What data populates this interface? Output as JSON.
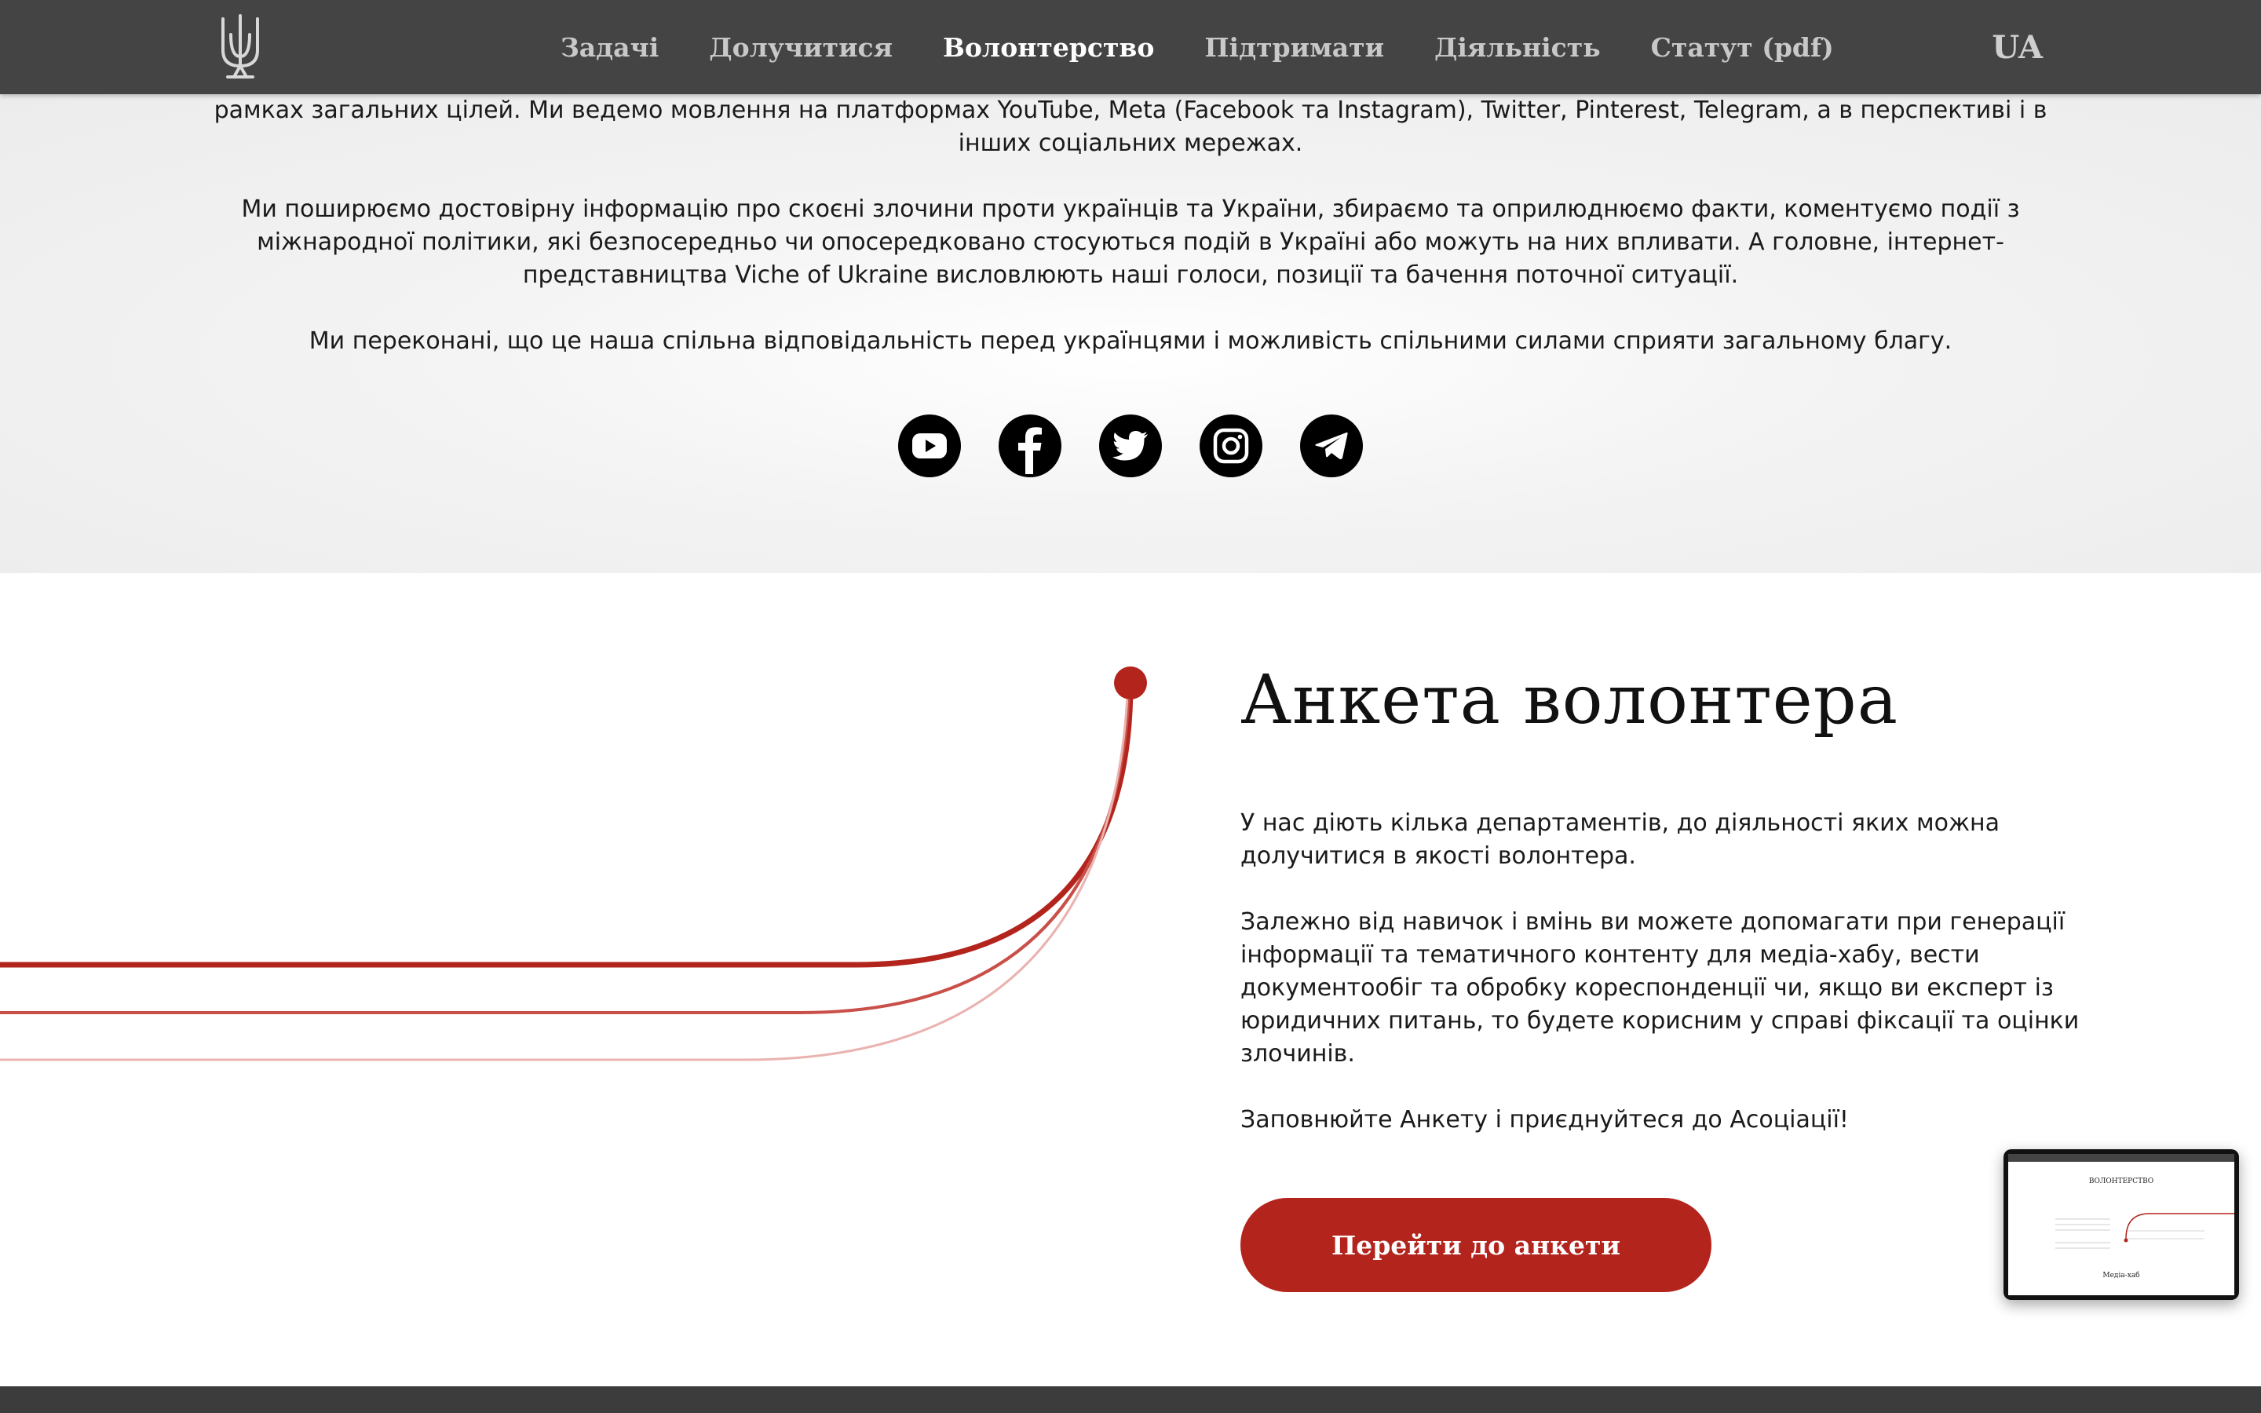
{
  "nav": {
    "items": [
      {
        "label": "Задачі"
      },
      {
        "label": "Долучитися"
      },
      {
        "label": "Волонтерство",
        "active": true
      },
      {
        "label": "Підтримати"
      },
      {
        "label": "Діяльність"
      },
      {
        "label": "Статут (pdf)"
      }
    ],
    "language": "UA"
  },
  "about": {
    "paragraphs": [
      "рамках загальних цілей. Ми ведемо мовлення на платформах YouTube, Meta (Facebook та Instagram), Twitter, Pinterest, Telegram, а в перспективі і в інших соціальних мережах.",
      "Ми поширюємо достовірну інформацію про скоєні злочини проти українців та України, збираємо та оприлюднюємо факти, коментуємо події з міжнародної політики, які безпосередньо чи опосередковано стосуються подій в Україні або можуть на них впливати. А головне, інтернет-представництва Viche of Ukraine висловлюють наші голоси, позиції та бачення поточної ситуації.",
      "Ми переконані, що це наша спільна відповідальність перед українцями і можливість спільними силами сприяти загальному благу."
    ],
    "socials": [
      "youtube-icon",
      "facebook-icon",
      "twitter-icon",
      "instagram-icon",
      "telegram-icon"
    ]
  },
  "volunteer": {
    "title": "Анкета волонтера",
    "paragraphs": [
      "У нас діють кілька департаментів, до діяльності яких можна долучитися в якості волонтера.",
      "Залежно від навичок і вмінь ви можете допомагати при генерації інформації та тематичного контенту для медіа-хабу, вести документообіг та обробку кореспонденції чи, якщо ви експерт із юридичних питань, то будете корисним у справі фіксації та оцінки злочинів.",
      "Заповнюйте Анкету і приєднуйтеся до Асоціації!"
    ],
    "button_label": "Перейти до анкети"
  },
  "preview": {
    "title": "ВОЛОНТЕРСТВО",
    "subtitle": "Медіа-хаб"
  },
  "colors": {
    "nav_bg": "#444444",
    "accent_red": "#b3241d",
    "footer_bg": "#3c3c3c"
  }
}
